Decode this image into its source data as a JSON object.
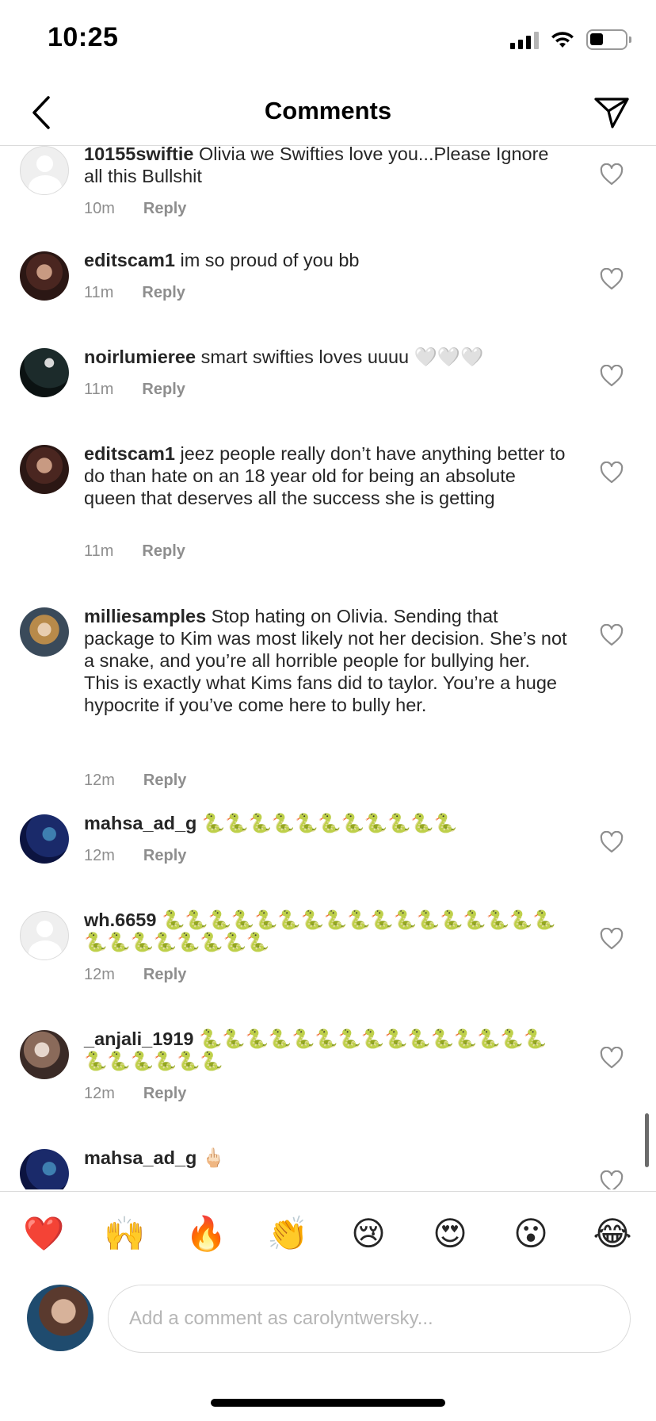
{
  "status_bar": {
    "time": "10:25",
    "battery_level": 0.38
  },
  "header": {
    "title": "Comments",
    "back_icon": "chevron-left-icon",
    "send_icon": "paper-plane-icon"
  },
  "comments": [
    {
      "username": "10155swiftie",
      "text": "Olivia we Swifties love you...Please Ignore all this Bullshit",
      "time": "10m",
      "reply": "Reply",
      "avatar": "default"
    },
    {
      "username": "editscam1",
      "text": "im so proud of you bb",
      "time": "11m",
      "reply": "Reply",
      "avatar": "photo"
    },
    {
      "username": "noirlumieree",
      "text": "smart swifties loves uuuu 🤍🤍🤍",
      "time": "11m",
      "reply": "Reply",
      "avatar": "photo"
    },
    {
      "username": "editscam1",
      "text": "jeez people really don’t have anything better to do than hate on an 18 year old for being an absolute queen that deserves all the success she is getting",
      "time": "11m",
      "reply": "Reply",
      "avatar": "photo"
    },
    {
      "username": "milliesamples",
      "text": "Stop hating on Olivia. Sending that package to Kim was most likely not her decision. She’s not a snake, and you’re all horrible people for bullying her. This is exactly what Kims fans did to taylor. You’re a huge hypocrite if you’ve come here to bully her.",
      "time": "12m",
      "reply": "Reply",
      "avatar": "photo"
    },
    {
      "username": "mahsa_ad_g",
      "text": "🐍🐍🐍🐍🐍🐍🐍🐍🐍🐍🐍",
      "time": "12m",
      "reply": "Reply",
      "avatar": "photo"
    },
    {
      "username": "wh.6659",
      "text": "🐍🐍🐍🐍🐍🐍🐍🐍🐍🐍🐍🐍🐍🐍🐍🐍🐍🐍🐍🐍🐍🐍🐍🐍🐍",
      "time": "12m",
      "reply": "Reply",
      "avatar": "default"
    },
    {
      "username": "_anjali_1919",
      "text": "🐍🐍🐍🐍🐍🐍🐍🐍🐍🐍🐍🐍🐍🐍🐍🐍🐍🐍🐍🐍🐍",
      "time": "12m",
      "reply": "Reply",
      "avatar": "photo"
    },
    {
      "username": "mahsa_ad_g",
      "text": "🖕🏻",
      "time": "",
      "reply": "",
      "avatar": "photo"
    }
  ],
  "reactions": [
    "❤️",
    "🙌",
    "🔥",
    "👏",
    "😢",
    "😍",
    "😮",
    "😂"
  ],
  "composer": {
    "placeholder": "Add a comment as carolyntwersky..."
  }
}
